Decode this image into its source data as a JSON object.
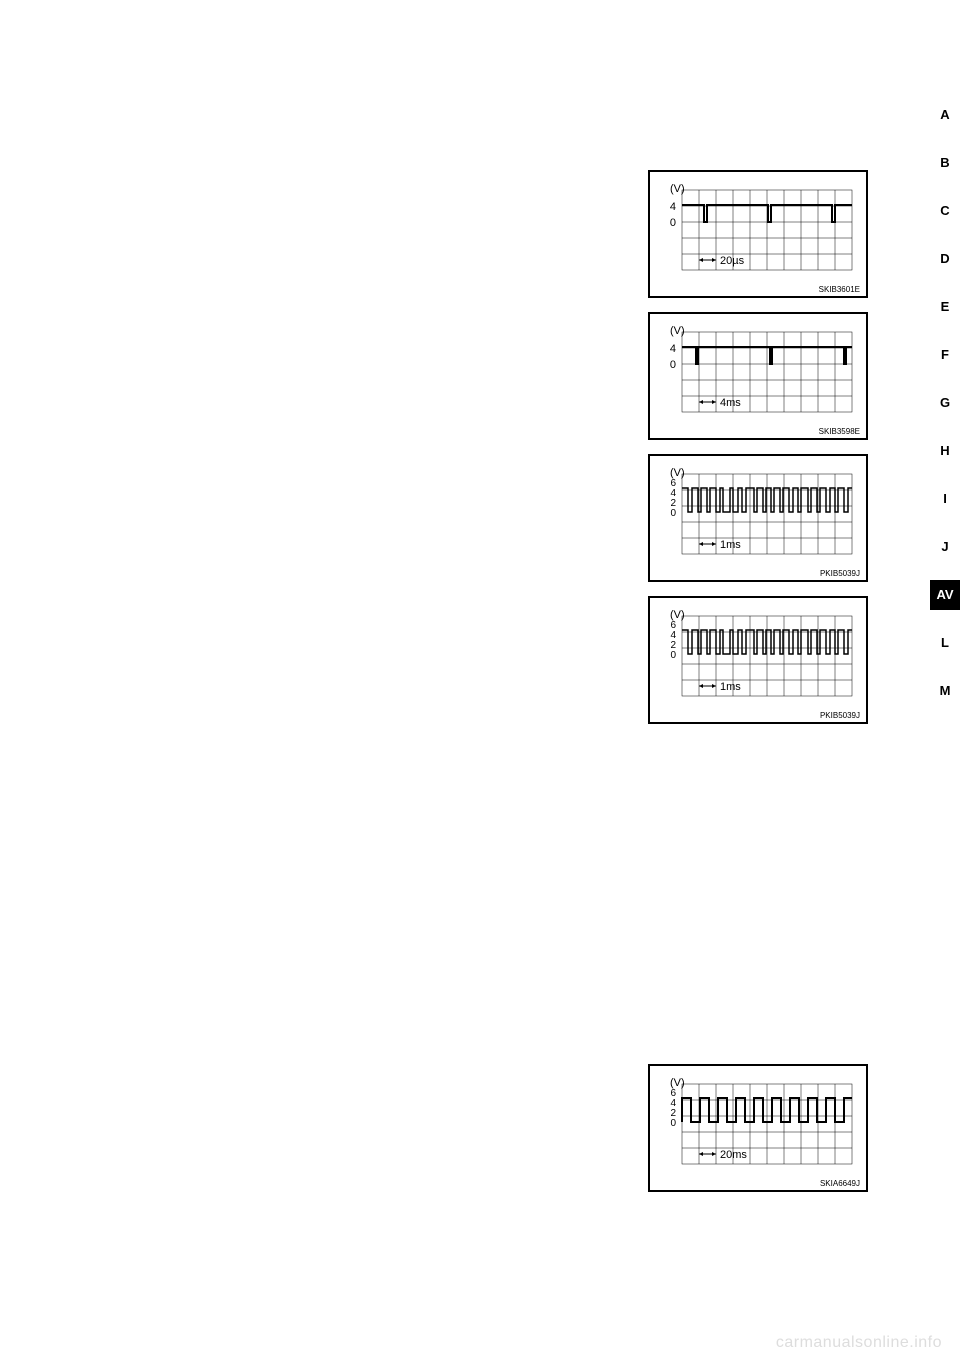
{
  "side_tabs": {
    "items": [
      {
        "label": "A",
        "active": false
      },
      {
        "label": "B",
        "active": false
      },
      {
        "label": "C",
        "active": false
      },
      {
        "label": "D",
        "active": false
      },
      {
        "label": "E",
        "active": false
      },
      {
        "label": "F",
        "active": false
      },
      {
        "label": "G",
        "active": false
      },
      {
        "label": "H",
        "active": false
      },
      {
        "label": "I",
        "active": false
      },
      {
        "label": "J",
        "active": false
      },
      {
        "label": "AV",
        "active": true
      },
      {
        "label": "L",
        "active": false
      },
      {
        "label": "M",
        "active": false
      }
    ]
  },
  "charts": [
    {
      "id": "SKIB3601E",
      "y_unit": "(V)",
      "y_ticks": [
        "4",
        "0"
      ],
      "timebase": "20µs",
      "waveform_type": "narrow_negative_pulses",
      "baseline_level": 4,
      "pulse_level": 0,
      "pulse_count_visible": 3
    },
    {
      "id": "SKIB3598E",
      "y_unit": "(V)",
      "y_ticks": [
        "4",
        "0"
      ],
      "timebase": "4ms",
      "waveform_type": "narrow_negative_pulses",
      "baseline_level": 4,
      "pulse_level": 0,
      "pulse_count_visible": 3
    },
    {
      "id": "PKIB5039J",
      "y_unit": "(V)",
      "y_ticks": [
        "6",
        "4",
        "2",
        "0"
      ],
      "timebase": "1ms",
      "waveform_type": "dense_square_burst",
      "high_level": 5,
      "low_level": 0
    },
    {
      "id": "PKIB5039J",
      "y_unit": "(V)",
      "y_ticks": [
        "6",
        "4",
        "2",
        "0"
      ],
      "timebase": "1ms",
      "waveform_type": "dense_square_burst",
      "high_level": 5,
      "low_level": 0
    },
    {
      "id": "SKIA6649J",
      "y_unit": "(V)",
      "y_ticks": [
        "6",
        "4",
        "2",
        "0"
      ],
      "timebase": "20ms",
      "waveform_type": "regular_square",
      "high_level": 5,
      "low_level": 0,
      "cycles_visible": 9
    }
  ],
  "watermark": "carmanualsonline.info",
  "chart_data": [
    {
      "type": "line",
      "title": "",
      "xlabel": "time",
      "ylabel": "(V)",
      "time_per_div": "20µs",
      "ylim": [
        0,
        4
      ],
      "series": [
        {
          "name": "signal",
          "description": "flat at ~4V with 3 narrow negative pulses to 0V"
        }
      ],
      "ref": "SKIB3601E"
    },
    {
      "type": "line",
      "title": "",
      "xlabel": "time",
      "ylabel": "(V)",
      "time_per_div": "4ms",
      "ylim": [
        0,
        4
      ],
      "series": [
        {
          "name": "signal",
          "description": "flat at ~4V with 3 narrow negative pulses to 0V"
        }
      ],
      "ref": "SKIB3598E"
    },
    {
      "type": "line",
      "title": "",
      "xlabel": "time",
      "ylabel": "(V)",
      "time_per_div": "1ms",
      "ylim": [
        0,
        6
      ],
      "series": [
        {
          "name": "signal",
          "description": "dense burst of square pulses between ~0V and ~5V"
        }
      ],
      "ref": "PKIB5039J"
    },
    {
      "type": "line",
      "title": "",
      "xlabel": "time",
      "ylabel": "(V)",
      "time_per_div": "1ms",
      "ylim": [
        0,
        6
      ],
      "series": [
        {
          "name": "signal",
          "description": "dense burst of square pulses between ~0V and ~5V"
        }
      ],
      "ref": "PKIB5039J"
    },
    {
      "type": "line",
      "title": "",
      "xlabel": "time",
      "ylabel": "(V)",
      "time_per_div": "20ms",
      "ylim": [
        0,
        6
      ],
      "series": [
        {
          "name": "signal",
          "description": "regular square wave ~0V to ~5V, ~9 full cycles across window"
        }
      ],
      "ref": "SKIA6649J"
    }
  ]
}
